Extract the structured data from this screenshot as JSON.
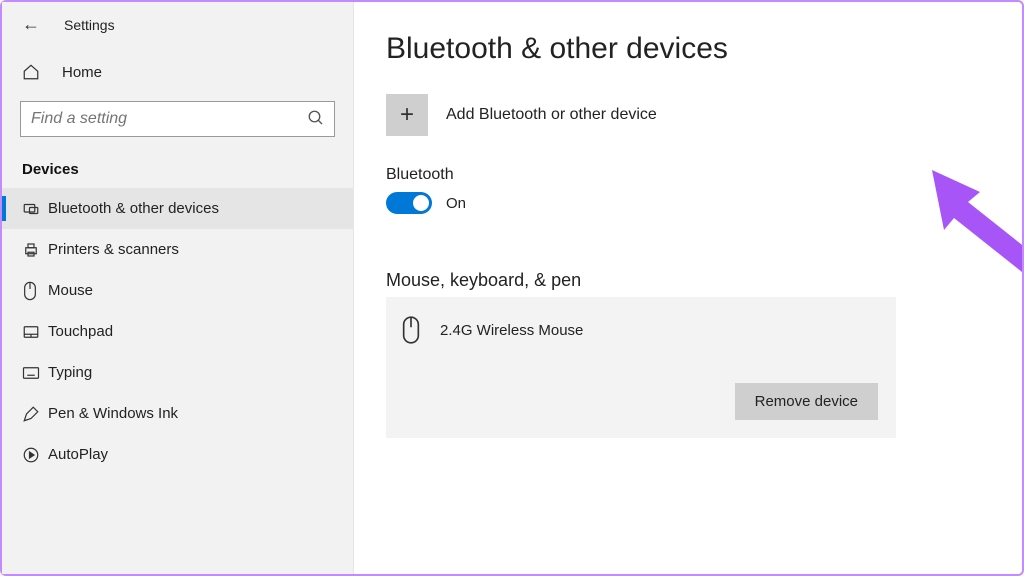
{
  "window": {
    "title": "Settings"
  },
  "sidebar": {
    "home_label": "Home",
    "search_placeholder": "Find a setting",
    "section_label": "Devices",
    "items": [
      {
        "label": "Bluetooth & other devices",
        "icon": "bluetooth"
      },
      {
        "label": "Printers & scanners",
        "icon": "printer"
      },
      {
        "label": "Mouse",
        "icon": "mouse"
      },
      {
        "label": "Touchpad",
        "icon": "touchpad"
      },
      {
        "label": "Typing",
        "icon": "keyboard"
      },
      {
        "label": "Pen & Windows Ink",
        "icon": "pen"
      },
      {
        "label": "AutoPlay",
        "icon": "autoplay"
      }
    ]
  },
  "main": {
    "page_title": "Bluetooth & other devices",
    "add_device_label": "Add Bluetooth or other device",
    "bluetooth_label": "Bluetooth",
    "bluetooth_state": "On",
    "device_group_title": "Mouse, keyboard, & pen",
    "device_name": "2.4G Wireless Mouse",
    "remove_button": "Remove device"
  },
  "colors": {
    "accent": "#0078d7",
    "annotation": "#a855f7"
  }
}
